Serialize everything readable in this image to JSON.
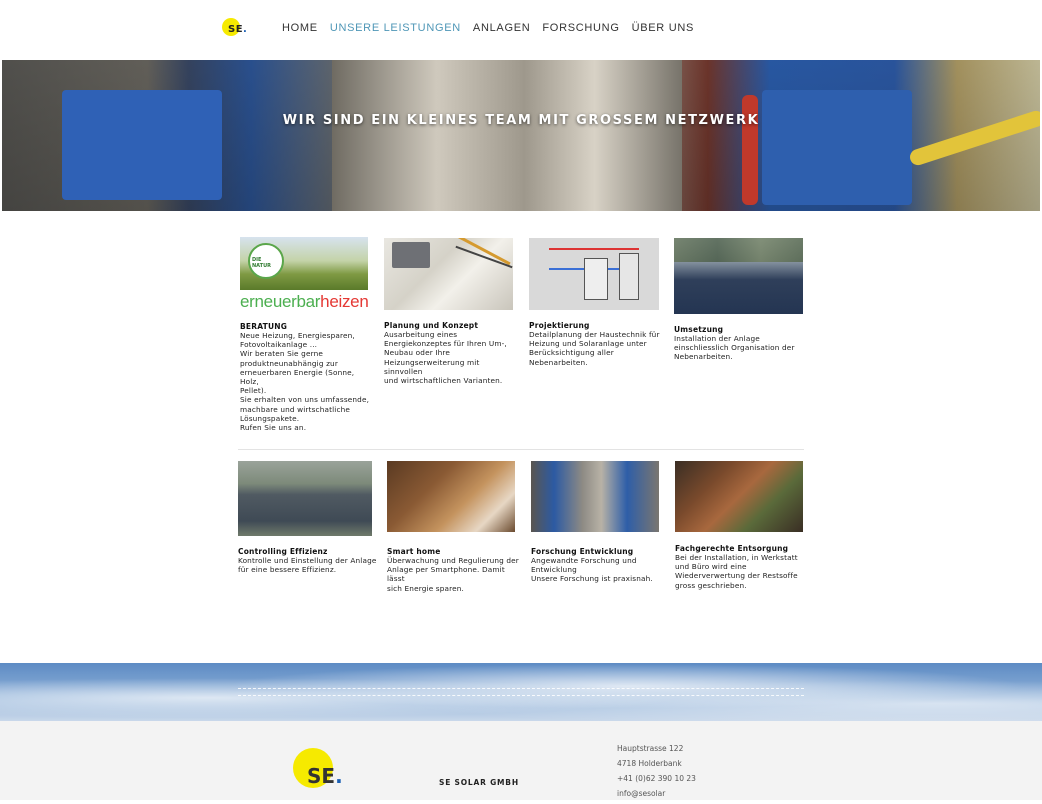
{
  "header": {
    "logo_text": "SE",
    "logo_dot": ".",
    "nav": [
      "HOME",
      "UNSERE LEISTUNGEN",
      "ANLAGEN",
      "FORSCHUNG",
      "ÜBER UNS"
    ],
    "active_nav": "UNSERE LEISTUNGEN"
  },
  "hero": {
    "title": "WIR SIND EIN KLEINES TEAM MIT GROSSEM NETZWERK"
  },
  "services_row1": [
    {
      "title": "BERATUNG",
      "desc": "Neue Heizung, Energiesparen,\nFotovoltaikanlage ...\nWir beraten Sie gerne\nproduktneunabhängig zur\nerneuerbaren Energie (Sonne, Holz,\nPellet).\nSie erhalten von uns umfassende,\nmachbare und wirtschatliche\nLösungspakete.\nRufen Sie uns an.",
      "image": "erneuerbarheizen",
      "image_text": "DIE NATUR"
    },
    {
      "title": "Planung und Konzept",
      "desc": "Ausarbeitung eines\nEnergiekonzeptes für Ihren Um-,\nNeubau oder Ihre\nHeizungserweiterung mit sinnvollen\nund wirtschaftlichen Varianten.",
      "image": "plans"
    },
    {
      "title": "Projektierung",
      "desc": "Detailplanung der Haustechnik für\nHeizung und Solaranlage unter\nBerücksichtigung aller\nNebenarbeiten.",
      "image": "diagram"
    },
    {
      "title": "Umsetzung",
      "desc": "Installation der Anlage\neinschliesslich Organisation der\nNebenarbeiten.",
      "image": "solar-field"
    }
  ],
  "services_row2": [
    {
      "title": "Controlling Effizienz",
      "desc": "Kontrolle und Einstellung der Anlage\nfür eine bessere Effizienz.",
      "image": "roof"
    },
    {
      "title": "Smart home",
      "desc": "Überwachung und Regulierung der\nAnlage per Smartphone. Damit lässt\nsich Energie sparen.",
      "image": "sofa"
    },
    {
      "title": "Forschung Entwicklung",
      "desc": "Angewandte Forschung und\nEntwicklung\nUnsere Forschung ist praxisnah.",
      "image": "lab"
    },
    {
      "title": "Fachgerechte Entsorgung",
      "desc": "Bei der Installation, in Werkstatt\nund Büro wird eine\nWiederverwertung der Restsoffe\ngross geschrieben.",
      "image": "pipes"
    }
  ],
  "erneuerbar": {
    "green": "erneuerbar",
    "red": "heizen"
  },
  "footer": {
    "logo_text": "SE",
    "logo_dot": ".",
    "company": "SE SOLAR GMBH",
    "address": [
      "Hauptstrasse 122",
      "4718 Holderbank",
      "+41 (0)62 390 10 23",
      "info@sesolar"
    ]
  },
  "colors": {
    "accent_nav": "#4f97b7",
    "logo_yellow": "#f6ea00",
    "logo_blue": "#1a5fb4"
  }
}
